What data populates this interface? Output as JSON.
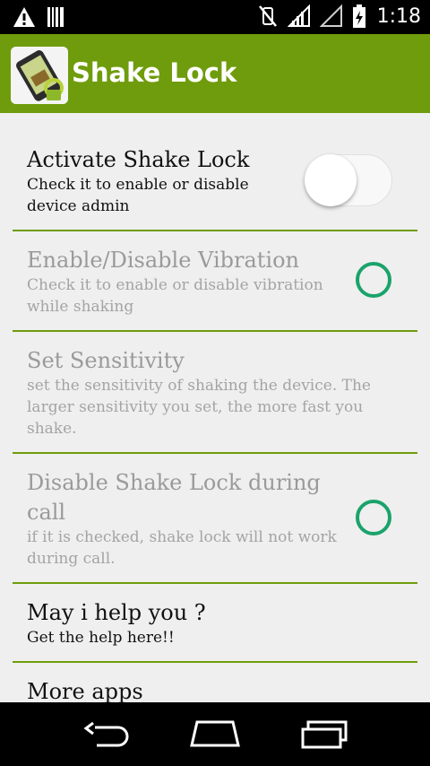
{
  "status_bar": {
    "time": "1:18",
    "icons": [
      "warning-icon",
      "barcode-icon",
      "vibrate-off-icon",
      "signal-icon",
      "no-signal-icon",
      "battery-charging-icon"
    ]
  },
  "app_bar": {
    "title": "Shake Lock",
    "logo_icon": "shake-lock-logo-icon"
  },
  "colors": {
    "accent": "#6f9c0c",
    "radio": "#1aa36b",
    "background": "#efefef"
  },
  "settings": [
    {
      "title": "Activate Shake Lock",
      "summary_line1": "Check it to enable or disable",
      "summary_line2": "device admin",
      "control": "toggle",
      "checked": false,
      "enabled": true
    },
    {
      "title": "Enable/Disable Vibration",
      "summary_line1": "Check it to enable or disable vibration",
      "summary_line2": "while shaking",
      "control": "radio",
      "checked": false,
      "enabled": false
    },
    {
      "title": "Set Sensitivity",
      "summary_line1": "set the sensitivity of shaking the device. The",
      "summary_line2": "larger sensitivity you set, the more fast you",
      "summary_line3": "shake.",
      "enabled": false
    },
    {
      "title_line1": "Disable Shake Lock during",
      "title_line2": "call",
      "summary_line1": "if it is checked, shake lock will not work",
      "summary_line2": "during call.",
      "control": "radio",
      "checked": false,
      "enabled": false
    },
    {
      "title": "May i help you ?",
      "summary_line1": "Get the help here!!",
      "enabled": true
    },
    {
      "title": "More apps",
      "enabled": true
    }
  ],
  "nav_bar": {
    "icons": [
      "back-icon",
      "home-icon",
      "recent-apps-icon"
    ]
  }
}
